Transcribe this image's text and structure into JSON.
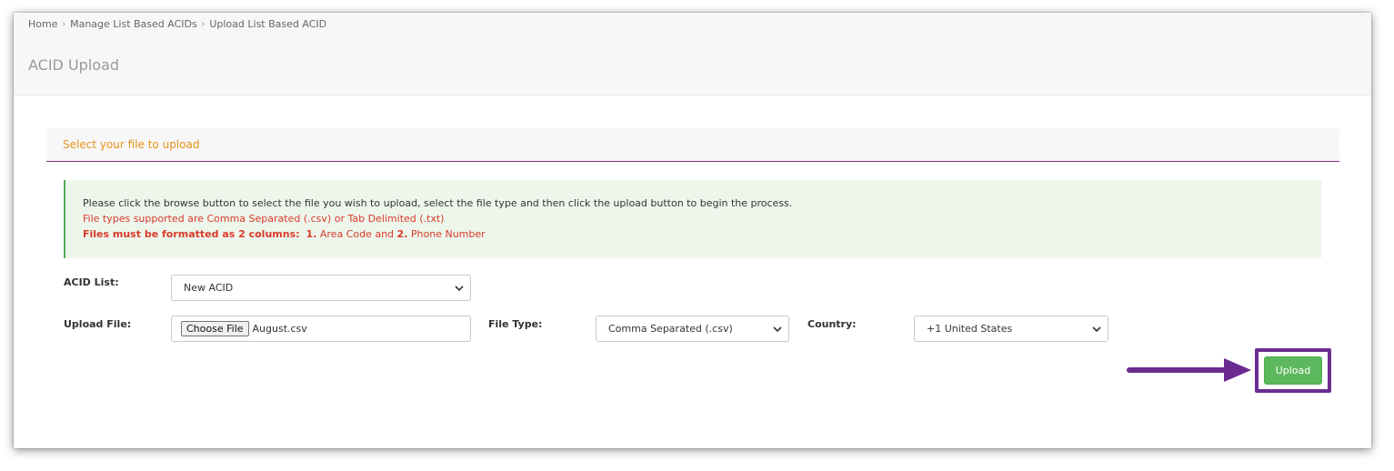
{
  "breadcrumb": {
    "items": [
      "Home",
      "Manage List Based ACIDs",
      "Upload List Based ACID"
    ],
    "separator": "›"
  },
  "page_title": "ACID Upload",
  "panel": {
    "heading": "Select your file to upload"
  },
  "info": {
    "line1": "Please click the browse button to select the file you wish to upload, select the file type and then click the upload button to begin the process.",
    "line2": "File types supported are Comma Separated (.csv) or Tab Delimited (.txt)",
    "line3_bold": "Files must be formatted as 2 columns:",
    "line3_num1": "1.",
    "line3_text1": "Area Code and",
    "line3_num2": "2.",
    "line3_text2": "Phone Number"
  },
  "form": {
    "acid_list_label": "ACID List:",
    "acid_list_value": "New ACID",
    "upload_file_label": "Upload File:",
    "choose_file_label": "Choose File",
    "file_name": "August.csv",
    "file_type_label": "File Type:",
    "file_type_value": "Comma Separated (.csv)",
    "country_label": "Country:",
    "country_value": "+1 United States",
    "upload_button": "Upload"
  },
  "colors": {
    "panel_heading_text": "#e8911b",
    "panel_underline": "#7b2f7b",
    "info_bg": "#eef6ec",
    "info_border": "#55a955",
    "warning_text": "#d83a2a",
    "upload_button_bg": "#5cb85c",
    "highlight_frame": "#6a2c91"
  },
  "icons": {
    "breadcrumb_separator": "chevron-right-icon",
    "select_chevron": "chevron-down-icon",
    "annotation_arrow": "arrow-right-icon"
  }
}
